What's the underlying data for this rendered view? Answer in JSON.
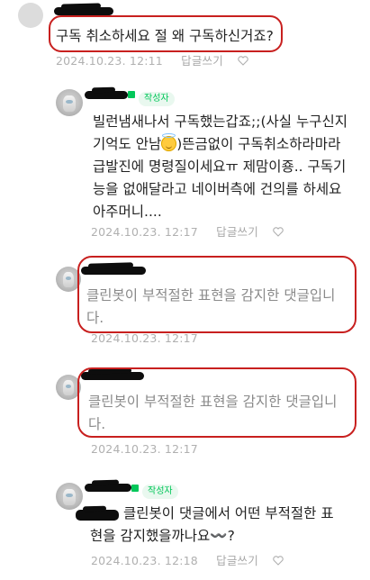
{
  "comments": [
    {
      "body_lines": [
        "구독 취소하세요 절 왜 구독하신거죠?"
      ],
      "date": "2024.10.23. 12:11",
      "reply_label": "답글쓰기"
    },
    {
      "author_badge": "작성자",
      "body_lines": [
        "빌런냄새나서 구독했는갑죠;;(사실 누구신지",
        "기억도 안남",
        ")뜬금없이 구독취소하라마라",
        "급발진에 명령질이세요ㅠ 제맘이죵.. 구독기",
        "능을 없애달라고 네이버측에 건의를 하세요",
        "아주머니...."
      ],
      "date": "2024.10.23. 12:17",
      "reply_label": "답글쓰기"
    },
    {
      "body_lines": [
        "클린봇이 부적절한 표현을 감지한 댓글입니",
        "다."
      ],
      "date": "2024.10.23. 12:17"
    },
    {
      "body_lines": [
        "클린봇이 부적절한 표현을 감지한 댓글입니",
        "다."
      ],
      "date": "2024.10.23. 12:17"
    },
    {
      "author_badge": "작성자",
      "body_lines": [
        "클린봇이 댓글에서 어떤 부적절한 표",
        "현을 감지했을까나요〰️?"
      ],
      "date": "2024.10.23. 12:18",
      "reply_label": "답글쓰기"
    }
  ],
  "colors": {
    "badge_green": "#03c75a",
    "annotation_red": "#c8201f",
    "meta_gray": "#b0b0b0"
  },
  "icons": {
    "heart": "heart-outline-icon",
    "emoji": "smiling-face-with-halo-icon"
  }
}
